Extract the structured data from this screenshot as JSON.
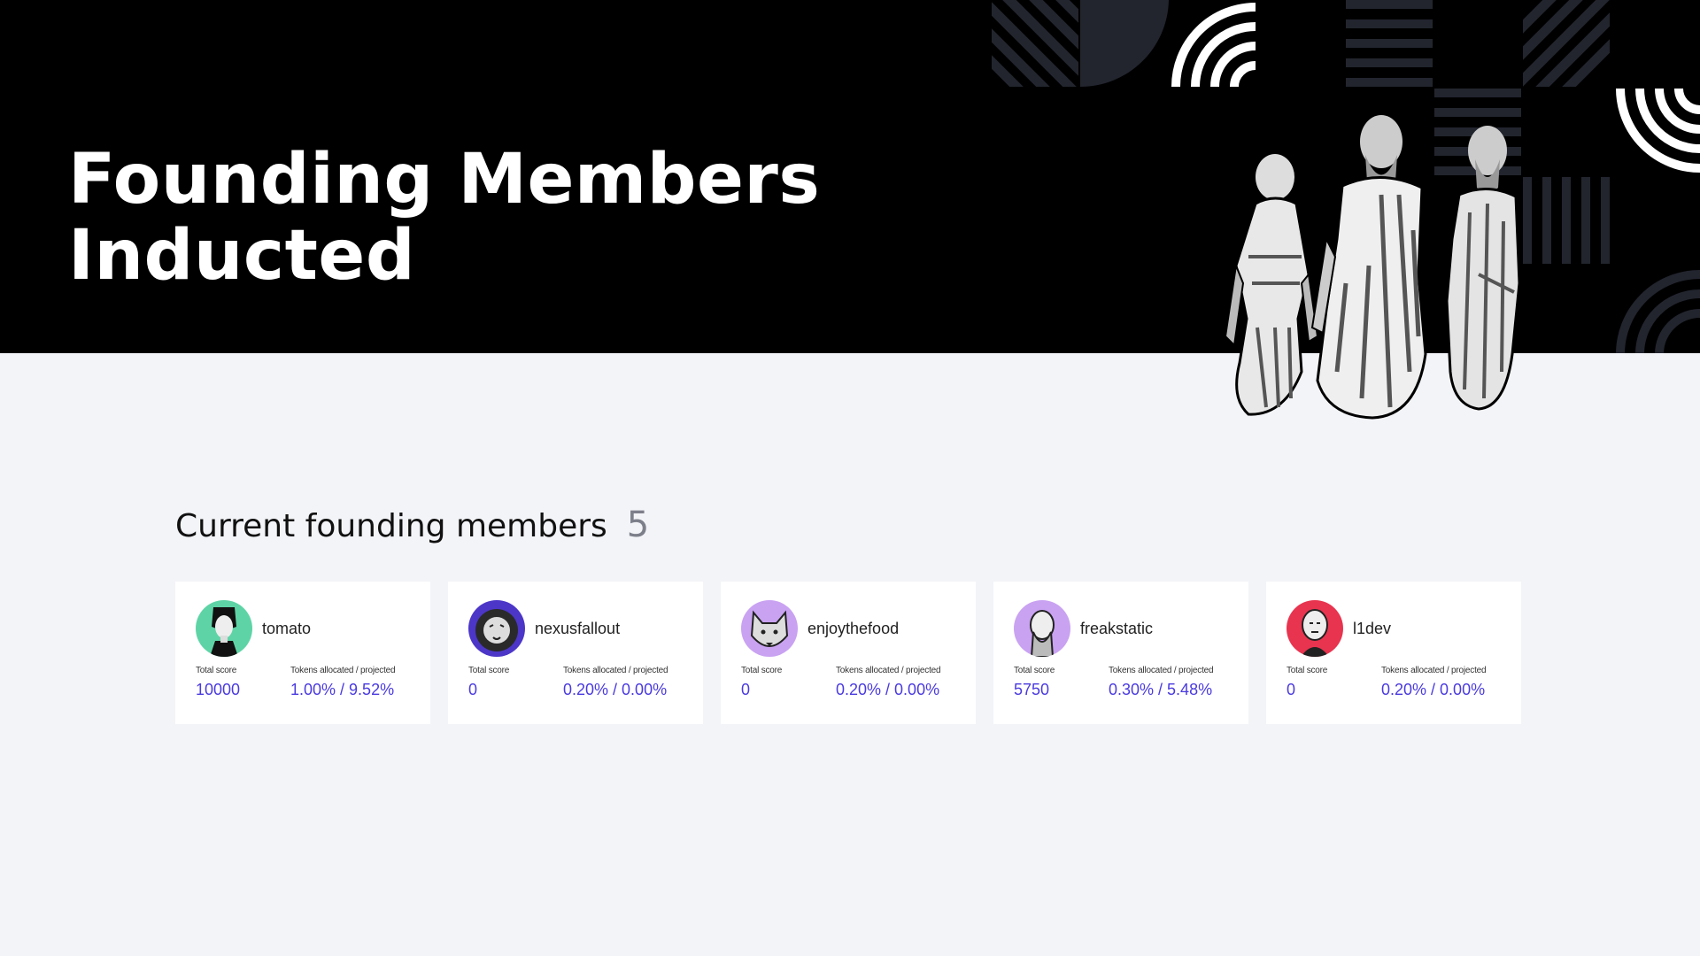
{
  "hero": {
    "title_line1": "Founding Members",
    "title_line2": "Inducted"
  },
  "section": {
    "title": "Current founding members",
    "count": "5"
  },
  "labels": {
    "total_score": "Total score",
    "tokens": "Tokens allocated / projected"
  },
  "members": [
    {
      "name": "tomato",
      "total_score": "10000",
      "tokens": "1.00% / 9.52%",
      "avatar_color": "#5ed4a6"
    },
    {
      "name": "nexusfallout",
      "total_score": "0",
      "tokens": "0.20% / 0.00%",
      "avatar_color": "#4b36c8"
    },
    {
      "name": "enjoythefood",
      "total_score": "0",
      "tokens": "0.20% / 0.00%",
      "avatar_color": "#c9a2f2"
    },
    {
      "name": "freakstatic",
      "total_score": "5750",
      "tokens": "0.30% / 5.48%",
      "avatar_color": "#c9a2f2"
    },
    {
      "name": "l1dev",
      "total_score": "0",
      "tokens": "0.20% / 0.00%",
      "avatar_color": "#e8344f"
    }
  ],
  "colors": {
    "accent": "#4a3ae0",
    "hero_bg": "#000000",
    "page_bg": "#f3f4f8",
    "pattern": "#22252e"
  }
}
